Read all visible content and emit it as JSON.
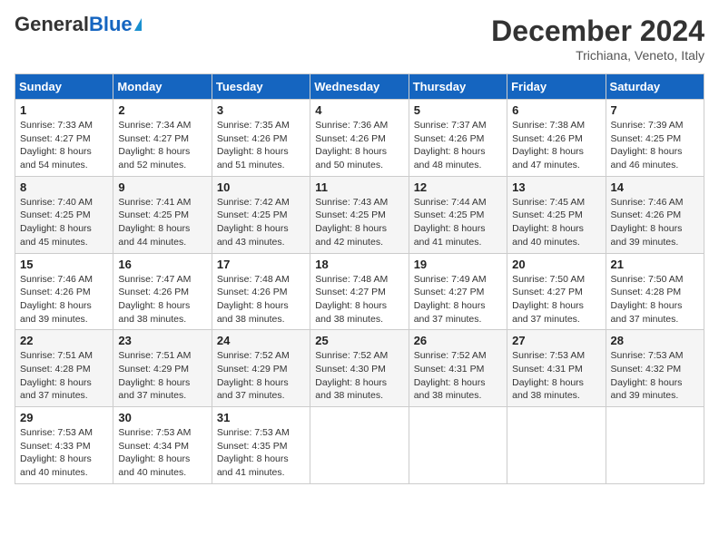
{
  "header": {
    "logo_general": "General",
    "logo_blue": "Blue",
    "month_title": "December 2024",
    "subtitle": "Trichiana, Veneto, Italy"
  },
  "weekdays": [
    "Sunday",
    "Monday",
    "Tuesday",
    "Wednesday",
    "Thursday",
    "Friday",
    "Saturday"
  ],
  "weeks": [
    [
      {
        "day": "1",
        "sunrise": "7:33 AM",
        "sunset": "4:27 PM",
        "daylight": "8 hours and 54 minutes."
      },
      {
        "day": "2",
        "sunrise": "7:34 AM",
        "sunset": "4:27 PM",
        "daylight": "8 hours and 52 minutes."
      },
      {
        "day": "3",
        "sunrise": "7:35 AM",
        "sunset": "4:26 PM",
        "daylight": "8 hours and 51 minutes."
      },
      {
        "day": "4",
        "sunrise": "7:36 AM",
        "sunset": "4:26 PM",
        "daylight": "8 hours and 50 minutes."
      },
      {
        "day": "5",
        "sunrise": "7:37 AM",
        "sunset": "4:26 PM",
        "daylight": "8 hours and 48 minutes."
      },
      {
        "day": "6",
        "sunrise": "7:38 AM",
        "sunset": "4:26 PM",
        "daylight": "8 hours and 47 minutes."
      },
      {
        "day": "7",
        "sunrise": "7:39 AM",
        "sunset": "4:25 PM",
        "daylight": "8 hours and 46 minutes."
      }
    ],
    [
      {
        "day": "8",
        "sunrise": "7:40 AM",
        "sunset": "4:25 PM",
        "daylight": "8 hours and 45 minutes."
      },
      {
        "day": "9",
        "sunrise": "7:41 AM",
        "sunset": "4:25 PM",
        "daylight": "8 hours and 44 minutes."
      },
      {
        "day": "10",
        "sunrise": "7:42 AM",
        "sunset": "4:25 PM",
        "daylight": "8 hours and 43 minutes."
      },
      {
        "day": "11",
        "sunrise": "7:43 AM",
        "sunset": "4:25 PM",
        "daylight": "8 hours and 42 minutes."
      },
      {
        "day": "12",
        "sunrise": "7:44 AM",
        "sunset": "4:25 PM",
        "daylight": "8 hours and 41 minutes."
      },
      {
        "day": "13",
        "sunrise": "7:45 AM",
        "sunset": "4:25 PM",
        "daylight": "8 hours and 40 minutes."
      },
      {
        "day": "14",
        "sunrise": "7:46 AM",
        "sunset": "4:26 PM",
        "daylight": "8 hours and 39 minutes."
      }
    ],
    [
      {
        "day": "15",
        "sunrise": "7:46 AM",
        "sunset": "4:26 PM",
        "daylight": "8 hours and 39 minutes."
      },
      {
        "day": "16",
        "sunrise": "7:47 AM",
        "sunset": "4:26 PM",
        "daylight": "8 hours and 38 minutes."
      },
      {
        "day": "17",
        "sunrise": "7:48 AM",
        "sunset": "4:26 PM",
        "daylight": "8 hours and 38 minutes."
      },
      {
        "day": "18",
        "sunrise": "7:48 AM",
        "sunset": "4:27 PM",
        "daylight": "8 hours and 38 minutes."
      },
      {
        "day": "19",
        "sunrise": "7:49 AM",
        "sunset": "4:27 PM",
        "daylight": "8 hours and 37 minutes."
      },
      {
        "day": "20",
        "sunrise": "7:50 AM",
        "sunset": "4:27 PM",
        "daylight": "8 hours and 37 minutes."
      },
      {
        "day": "21",
        "sunrise": "7:50 AM",
        "sunset": "4:28 PM",
        "daylight": "8 hours and 37 minutes."
      }
    ],
    [
      {
        "day": "22",
        "sunrise": "7:51 AM",
        "sunset": "4:28 PM",
        "daylight": "8 hours and 37 minutes."
      },
      {
        "day": "23",
        "sunrise": "7:51 AM",
        "sunset": "4:29 PM",
        "daylight": "8 hours and 37 minutes."
      },
      {
        "day": "24",
        "sunrise": "7:52 AM",
        "sunset": "4:29 PM",
        "daylight": "8 hours and 37 minutes."
      },
      {
        "day": "25",
        "sunrise": "7:52 AM",
        "sunset": "4:30 PM",
        "daylight": "8 hours and 38 minutes."
      },
      {
        "day": "26",
        "sunrise": "7:52 AM",
        "sunset": "4:31 PM",
        "daylight": "8 hours and 38 minutes."
      },
      {
        "day": "27",
        "sunrise": "7:53 AM",
        "sunset": "4:31 PM",
        "daylight": "8 hours and 38 minutes."
      },
      {
        "day": "28",
        "sunrise": "7:53 AM",
        "sunset": "4:32 PM",
        "daylight": "8 hours and 39 minutes."
      }
    ],
    [
      {
        "day": "29",
        "sunrise": "7:53 AM",
        "sunset": "4:33 PM",
        "daylight": "8 hours and 40 minutes."
      },
      {
        "day": "30",
        "sunrise": "7:53 AM",
        "sunset": "4:34 PM",
        "daylight": "8 hours and 40 minutes."
      },
      {
        "day": "31",
        "sunrise": "7:53 AM",
        "sunset": "4:35 PM",
        "daylight": "8 hours and 41 minutes."
      },
      null,
      null,
      null,
      null
    ]
  ],
  "labels": {
    "sunrise": "Sunrise:",
    "sunset": "Sunset:",
    "daylight": "Daylight:"
  }
}
